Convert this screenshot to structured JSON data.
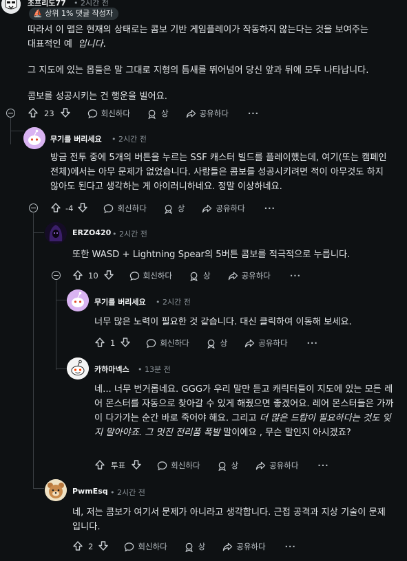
{
  "actions": {
    "reply": "회신하다",
    "award": "상",
    "share": "공유하다",
    "more": "···"
  },
  "top": {
    "username": "조프리도77",
    "time": "• 2시간 전",
    "badge": "상위 1% 댓글 작성자",
    "p1a": "따라서 이 맵은 현재의 상태로는 콤보 기반 게임플레이가 작동하지 않는다는 것을 보여주는",
    "p1b": "대표적인 예",
    "p1c": "입니다",
    "p1d": ".",
    "p2": "그 지도에 있는 몹들은 말 그대로 지형의 틈새를 뛰어넘어 당신 앞과 뒤에 모두 나타납니다.",
    "p3": "콤보를 성공시키는 건 행운을 빌어요.",
    "votes": "23"
  },
  "c1": {
    "username": "무기를 버리세요",
    "time": "• 2시간 전",
    "text": "방금 전투 중에 5개의 버튼을 누르는 SSF 캐스터 빌드를 플레이했는데, 여기(또는 캠페인 전체)에서는 아무 문제가 없었습니다. 사람들은 콤보를 성공시키려면 적이 아무것도 하지 않아도 된다고 생각하는 게 아이러니하네요. 정말 이상하네요.",
    "votes": "-4"
  },
  "c2": {
    "username": "ERZO420",
    "time": "• 2시간 전",
    "text": "또한 WASD + Lightning Spear의 5버튼 콤보를 적극적으로 누릅니다.",
    "votes": "10"
  },
  "c3": {
    "username": "무기를 버리세요",
    "time": "• 2시간 전",
    "text": "너무 많은 노력이 필요한 것 같습니다. 대신 클릭하여 이동해 보세요.",
    "votes": "1"
  },
  "c4": {
    "username": "카하마넥스",
    "time": "• 13분 전",
    "t1": "네... 너무 번거롭네요. GGG가 우리 말만 듣고 캐릭터들이 지도에 있는 모든 레어 몬스터를 자동으로 찾아갈 수 있게 해줬으면 좋겠어요. 레어 몬스터들은 가까이 다가가는 순간 바로 죽어야 해요. 그리고 ",
    "t2": "더 많은 드랍이 필요하다는 것도 잊지 말아야죠. 그 멋진 전리품 폭발",
    "t3": " 말이에요 , 무슨 말인지 아시겠죠?",
    "votes": "투표"
  },
  "c5": {
    "username": "PwmEsq",
    "time": "• 2시간 전",
    "text": "네, 저는 콤보가 여기서 문제가 아니라고 생각합니다. 근접 공격과 지상 기술이 문제입니다.",
    "votes": "2"
  }
}
